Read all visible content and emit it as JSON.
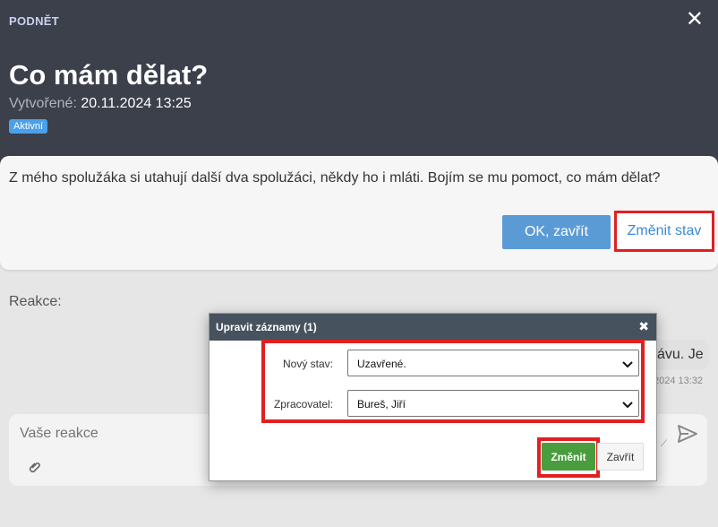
{
  "header": {
    "kicker": "PODNĚT",
    "title": "Co mám dělat?",
    "created_label": "Vytvořené:",
    "created_value": "20.11.2024 13:25",
    "status_badge": "Aktivní"
  },
  "card": {
    "message": "Z mého spolužáka si utahují další dva spolužáci, někdy ho i mláti. Bojím se mu pomoct, co mám dělat?",
    "ok_close_label": "OK, zavřít",
    "change_state_label": "Změnit stav"
  },
  "reactions": {
    "label": "Reakce:",
    "bubble_text_partial": "ávu. Je",
    "bubble_time_partial": "2024 13:32"
  },
  "reply": {
    "placeholder": "Vaše reakce"
  },
  "modal": {
    "title": "Upravit záznamy (1)",
    "new_state_label": "Nový stav:",
    "new_state_value": "Uzavřené.",
    "assignee_label": "Zpracovatel:",
    "assignee_value": "Bureš, Jiří",
    "confirm_label": "Změnit",
    "close_label": "Zavřít"
  },
  "colors": {
    "header_bg": "#3c404b",
    "accent_blue": "#5b9bd5",
    "highlight_red": "#e02020",
    "confirm_green": "#4a9d3e"
  }
}
